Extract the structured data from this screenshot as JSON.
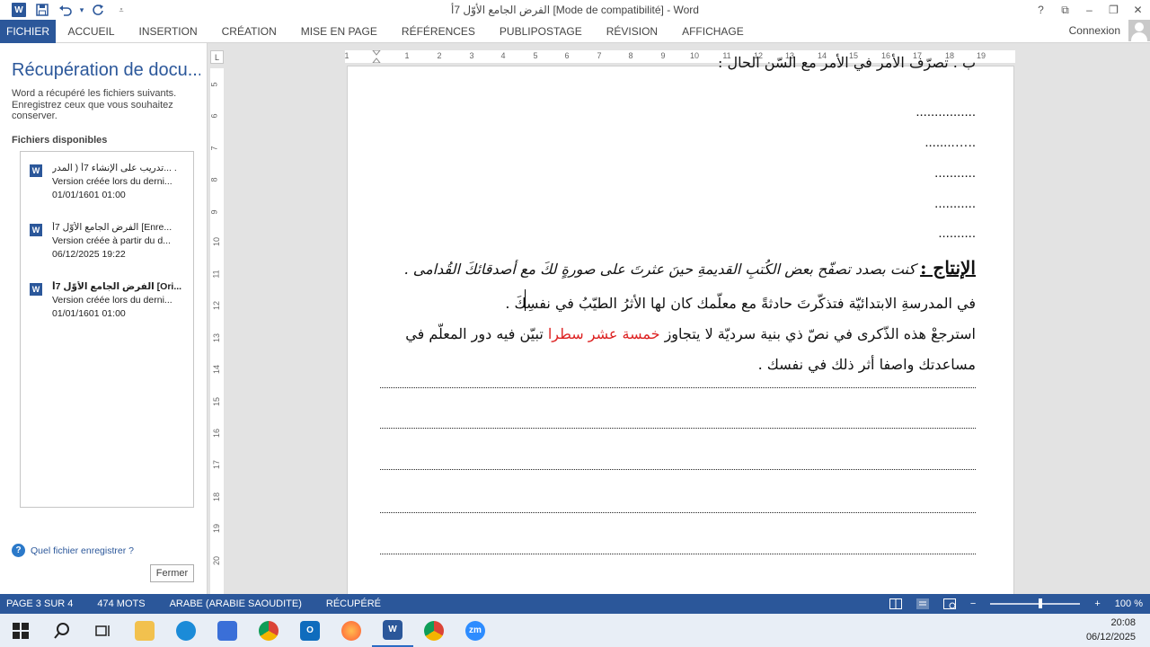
{
  "window": {
    "title": "الفرض الجامع الأوّل 7أ [Mode de compatibilité] - Word",
    "controls": [
      "?",
      "⧉",
      "–",
      "❐",
      "✕"
    ]
  },
  "quick_access": [
    "word-icon",
    "save-icon",
    "undo-icon",
    "redo-icon",
    "customize-icon"
  ],
  "ribbon": {
    "tabs": [
      "FICHIER",
      "ACCUEIL",
      "INSERTION",
      "CRÉATION",
      "MISE EN PAGE",
      "RÉFÉRENCES",
      "PUBLIPOSTAGE",
      "RÉVISION",
      "AFFICHAGE"
    ],
    "signin": "Connexion"
  },
  "recovery": {
    "title": "Récupération de docu...",
    "description": "Word a récupéré les fichiers suivants. Enregistrez ceux que vous souhaitez conserver.",
    "subtitle": "Fichiers disponibles",
    "files": [
      {
        "name": "تدريب على الإنشاء 7أ ( المدر...  .",
        "version": "Version créée lors du derni...",
        "date": "01/01/1601 01:00",
        "bold": false
      },
      {
        "name": "الفرض الجامع الأوّل 7أ  [Enre...",
        "version": "Version créée à partir du d...",
        "date": "06/12/2025 19:22",
        "bold": false
      },
      {
        "name": "الفرض الجامع الأوّل 7أ  [Ori...",
        "version": "Version créée lors du derni...",
        "date": "01/01/1601 01:00",
        "bold": true
      }
    ],
    "help": "Quel fichier enregistrer ?",
    "close": "Fermer"
  },
  "ruler": {
    "corner": "L",
    "h_ticks": [
      "1",
      "1",
      "2",
      "3",
      "4",
      "5",
      "6",
      "7",
      "8",
      "9",
      "10",
      "11",
      "12",
      "13",
      "14",
      "15",
      "16",
      "17",
      "18",
      "19"
    ],
    "v_ticks": [
      "5",
      "6",
      "7",
      "8",
      "9",
      "10",
      "11",
      "12",
      "13",
      "14",
      "15",
      "16",
      "17",
      "18",
      "19",
      "20"
    ]
  },
  "document": {
    "top_partial": "ب . تصرّف الأمر في الأمر مع السّن الحال :",
    "dots": [
      "................",
      "........…..",
      "...........",
      "...........",
      ".........."
    ],
    "heading": "الإنتاج :",
    "para1": "كنت بصدد تصفّح بعض الكُتبِ القديمةِ حينَ عثرتَ على صورةٍ لكَ مع أصدقائكَ القُدامى   .",
    "para2": "في المدرسةِ الابتدائيّة فتذكّرتَ حادثةً مع معلّمك كان لها الأثرُ الطيّبُ في نفسِكَ .",
    "para3a": "استرجعْ هذه الذّكرى في نصّ ذي بنية سرديّة لا يتجاوز ",
    "para3red": "خمسة عشر سطرا",
    "para3b": " تبيّن فيه دور المعلّم في",
    "para4": "مساعدتك واصفا أثر ذلك في نفسك ."
  },
  "status": {
    "page": "PAGE 3 SUR 4",
    "words": "474 MOTS",
    "language": "ARABE (ARABIE SAOUDITE)",
    "state": "RÉCUPÉRÉ",
    "zoom": "100 %",
    "zoom_minus": "−",
    "zoom_plus": "+"
  },
  "taskbar": {
    "apps": [
      "windows-start",
      "search",
      "task-view",
      "file-explorer",
      "edge",
      "store",
      "chrome",
      "outlook",
      "firefox",
      "word",
      "chrome",
      "zoom"
    ],
    "time": "20:08",
    "date": "06/12/2025"
  },
  "colors": {
    "accent": "#2b579a",
    "red_text": "#dd2222"
  }
}
